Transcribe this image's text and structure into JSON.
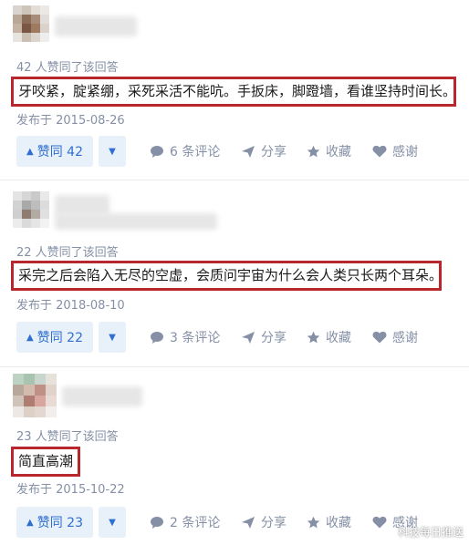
{
  "answers": [
    {
      "voters_text": "42 人赞同了该回答",
      "content": "牙咬紧，腚紧绷，采死采活不能吭。手扳床，脚蹬墙，看谁坚持时间长。",
      "date": "发布于 2015-08-26",
      "vote_label": "赞同 42",
      "comments": "6 条评论",
      "share": "分享",
      "collect": "收藏",
      "thanks": "感谢"
    },
    {
      "voters_text": "22 人赞同了该回答",
      "content": "采完之后会陷入无尽的空虚，会质问宇宙为什么会人类只长两个耳朵。",
      "date": "发布于 2018-08-10",
      "vote_label": "赞同 22",
      "comments": "3 条评论",
      "share": "分享",
      "collect": "收藏",
      "thanks": "感谢"
    },
    {
      "voters_text": "23 人赞同了该回答",
      "content": "简直高潮",
      "date": "发布于 2015-10-22",
      "vote_label": "赞同 23",
      "comments": "2 条评论",
      "share": "分享",
      "collect": "收藏",
      "thanks": "感谢"
    }
  ],
  "watermark": "科技每日推送",
  "colors": {
    "highlight_border": "#b8272d",
    "vote_bg": "#e8f0fa",
    "vote_text": "#2f6fd0",
    "meta_text": "#8590a6"
  }
}
